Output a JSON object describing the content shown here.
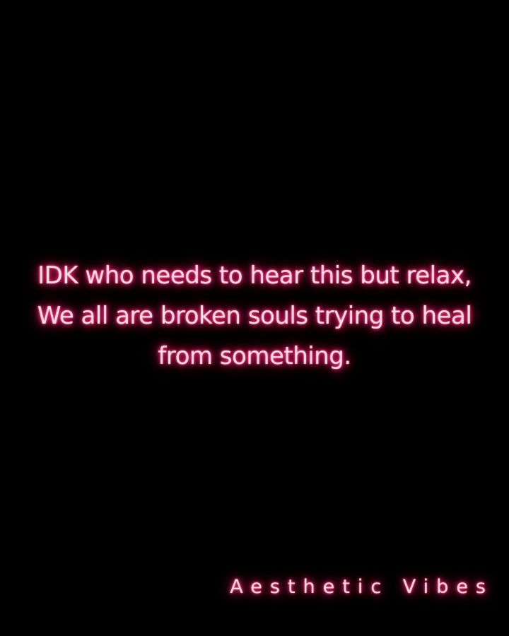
{
  "quote": {
    "lines": [
      "IDK who needs to hear this but relax,",
      "We all are broken souls trying to heal",
      "from something."
    ]
  },
  "signature": {
    "text": "Aesthetic Vibes"
  },
  "colors": {
    "background": "#000000",
    "text": "#ffd9e6",
    "glow": "#ff2d75"
  }
}
